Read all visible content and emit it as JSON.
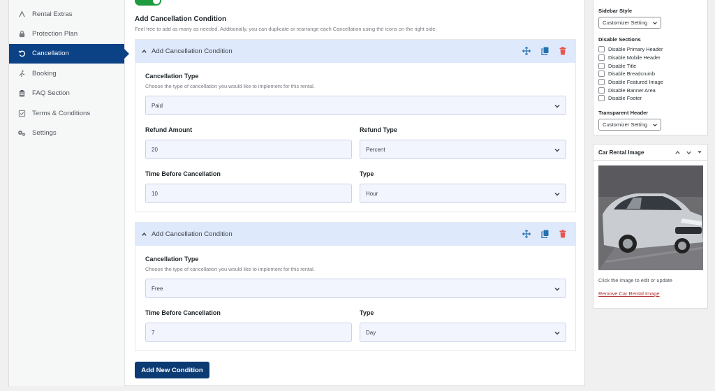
{
  "nav": {
    "items": [
      {
        "label": "Rental Extras",
        "icon": "rental-extras-icon",
        "active": false
      },
      {
        "label": "Protection Plan",
        "icon": "lock-icon",
        "active": false
      },
      {
        "label": "Cancellation",
        "icon": "undo-icon",
        "active": true
      },
      {
        "label": "Booking",
        "icon": "booking-icon",
        "active": false
      },
      {
        "label": "FAQ Section",
        "icon": "clipboard-icon",
        "active": false
      },
      {
        "label": "Terms & Conditions",
        "icon": "checklist-icon",
        "active": false
      },
      {
        "label": "Settings",
        "icon": "gears-icon",
        "active": false
      }
    ]
  },
  "section": {
    "toggle_text": "on",
    "title": "Add Cancellation Condition",
    "description": "Feel free to add as many as needed. Additionally, you can duplicate or rearrange each Cancellation using the icons on the right side."
  },
  "conditions": [
    {
      "header": "Add Cancellation Condition",
      "type_label": "Cancellation Type",
      "type_desc": "Choose the type of cancellation you would like to implement for this rental.",
      "type_value": "Paid",
      "refund_amount_label": "Refund Amount",
      "refund_amount_value": "20",
      "refund_type_label": "Refund Type",
      "refund_type_value": "Percent",
      "time_label": "Time Before Cancellation",
      "time_value": "10",
      "unit_label": "Type",
      "unit_value": "Hour"
    },
    {
      "header": "Add Cancellation Condition",
      "type_label": "Cancellation Type",
      "type_desc": "Choose the type of cancellation you would like to implement for this rental.",
      "type_value": "Free",
      "time_label": "Time Before Cancellation",
      "time_value": "7",
      "unit_label": "Type",
      "unit_value": "Day"
    }
  ],
  "add_button": "Add New Condition",
  "sidebar_options": {
    "sidebar_style_label": "Sidebar Style",
    "sidebar_style_value": "Customizer Setting",
    "disable_sections_label": "Disable Sections",
    "checkboxes": [
      "Disable Primary Header",
      "Disable Mobile Header",
      "Disable Title",
      "Disable Breadcrumb",
      "Disable Featured Image",
      "Disable Banner Area",
      "Disable Footer"
    ],
    "transparent_header_label": "Transparent Header",
    "transparent_header_value": "Customizer Setting"
  },
  "car_image_box": {
    "title": "Car Rental Image",
    "caption": "Click the image to edit or update",
    "remove_link": "Remove Car Rental Image"
  },
  "colors": {
    "active_tab": "#0b4285",
    "header_bg": "#dfe9fc",
    "button": "#0b3b73",
    "move_icon": "#2271b1",
    "delete_icon": "#e8554e",
    "toggle_on": "#1f9b3f"
  }
}
